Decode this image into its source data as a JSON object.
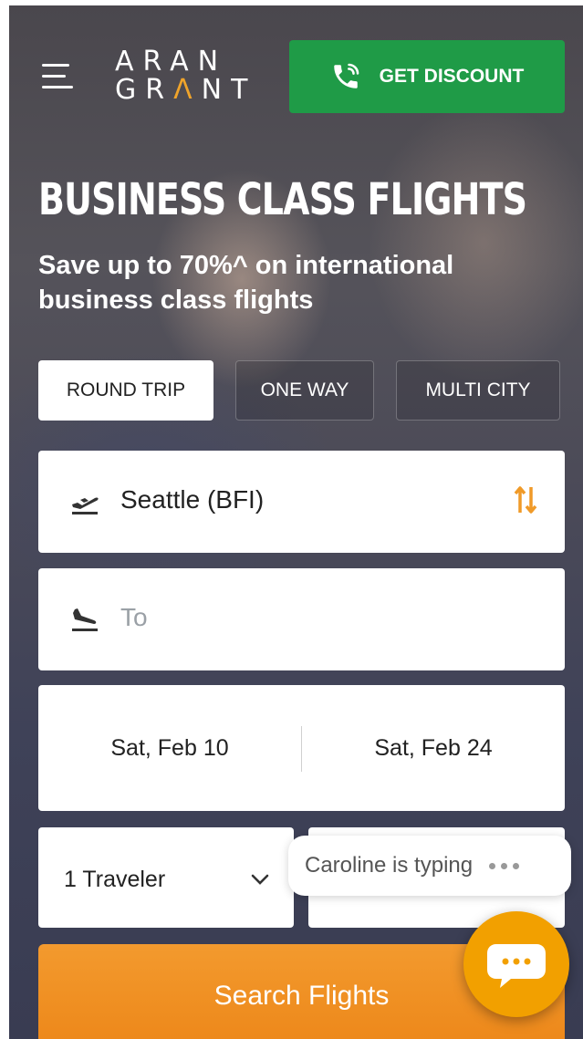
{
  "header": {
    "logo_line1": "ARAN",
    "logo_line2_a": "GR",
    "logo_line2_accent": "Λ",
    "logo_line2_b": "NT",
    "discount_button": "GET DISCOUNT"
  },
  "hero": {
    "title": "BUSINESS CLASS FLIGHTS",
    "subtitle": "Save up to 70%^ on international business class flights"
  },
  "trip_types": [
    "ROUND TRIP",
    "ONE WAY",
    "MULTI CITY"
  ],
  "selected_trip_type": "ROUND TRIP",
  "search": {
    "from_value": "Seattle (BFI)",
    "to_placeholder": "To",
    "depart_date": "Sat, Feb 10",
    "return_date": "Sat, Feb 24",
    "travelers": "1 Traveler",
    "submit_label": "Search Flights"
  },
  "chat": {
    "typing_text": "Caroline is typing"
  },
  "icons": {
    "menu": "hamburger-menu-icon",
    "phone": "phone-icon",
    "departure": "plane-takeoff-icon",
    "arrival": "plane-landing-icon",
    "swap": "swap-arrows-icon",
    "chevron": "chevron-down-icon",
    "chat": "chat-bubble-icon"
  },
  "colors": {
    "brand_green": "#1f9b47",
    "accent_orange": "#f39a2e",
    "chat_orange": "#f2a000",
    "logo_accent": "#f0a42b"
  }
}
